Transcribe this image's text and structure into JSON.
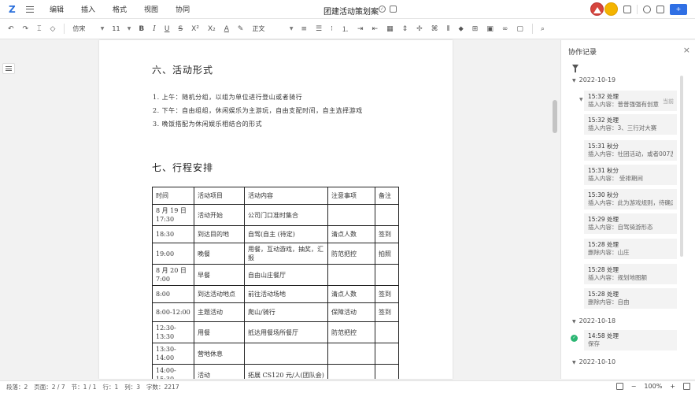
{
  "menubar": {
    "logo": "Z",
    "items": [
      "编辑",
      "插入",
      "格式",
      "视图",
      "协同"
    ],
    "doc_title": "团建活动策划案",
    "share_label": "+"
  },
  "toolbar": {
    "font_family": "仿宋",
    "font_size": "11",
    "bold": "B",
    "italic": "I",
    "underline": "U",
    "strike": "S",
    "superscript": "X²",
    "subscript": "X₂",
    "font_color": "A",
    "style": "正文"
  },
  "document": {
    "section6_title": "六、活动形式",
    "section6_items": [
      "1.  上午：随机分组，以组为单位进行登山或者骑行",
      "2.  下午：自由组组，休闲娱乐为主游玩，自由支配时间，自主选择游戏",
      "3.  晚饭搭配为休闲娱乐相结合的形式"
    ],
    "section7_title": "七、行程安排",
    "table": {
      "headers": [
        "时间",
        "活动项目",
        "活动内容",
        "注意事项",
        "备注"
      ],
      "rows": [
        [
          "8 月 19 日 17:30",
          "活动开始",
          "公司门口准时集合",
          "",
          ""
        ],
        [
          "18:30",
          "到达目的地",
          "自驾(自主 (待定)",
          "清点人数",
          "签到"
        ],
        [
          "19:00",
          "晚餐",
          "用餐，互动游戏，抽奖，汇报",
          "防范把控",
          "拍照"
        ],
        [
          "8 月 20 日 7:00",
          "早餐",
          "自由山庄餐厅",
          "",
          ""
        ],
        [
          "8:00",
          "到达活动地点",
          "前往活动场地",
          "清点人数",
          "签到"
        ],
        [
          "8:00-12:00",
          "主题活动",
          "爬山/骑行",
          "保障活动",
          "签到"
        ],
        [
          "12:30-13:30",
          "用餐",
          "抵达用餐场所餐厅",
          "防范把控",
          ""
        ],
        [
          "13:30-14:00",
          "营地休息",
          "",
          "",
          ""
        ],
        [
          "14:00-15:30",
          "活动",
          "拓展 CS120 元/人(团队会)",
          "",
          ""
        ]
      ]
    }
  },
  "panel": {
    "title": "协作记录",
    "close": "×",
    "groups": [
      {
        "date": "2022-10-19",
        "entries": [
          {
            "who": "15:32 处理",
            "what": "插入内容：普普强强有创意",
            "current": "当前"
          },
          {
            "who": "15:32 处理",
            "what": "插入内容：3、三行对大赛"
          },
          {
            "who": "15:31 秋分",
            "what": "插入内容：社团活动，或者007游戏"
          },
          {
            "who": "15:31 秋分",
            "what": "插入内容：  受排期间"
          },
          {
            "who": "15:30 秋分",
            "what": "插入内容：此为游戏规则，待确定"
          },
          {
            "who": "15:29 处理",
            "what": "插入内容：自驾骑游形态"
          },
          {
            "who": "15:28 处理",
            "what": "删除内容：山庄"
          },
          {
            "who": "15:28 处理",
            "what": "插入内容：规划地图额"
          },
          {
            "who": "15:28 处理",
            "what": "删除内容：自由"
          }
        ]
      },
      {
        "date": "2022-10-18",
        "entries": [
          {
            "who": "14:58 处理",
            "what": "保存"
          }
        ]
      },
      {
        "date": "2022-10-10",
        "entries": []
      }
    ]
  },
  "statusbar": {
    "items": [
      "段落：2",
      "页面：2 / 7",
      "节：1 / 1",
      "行：1",
      "列：3",
      "字数：2217"
    ],
    "zoom": "100%"
  },
  "colors": {
    "accent": "#2f6fe4",
    "avatar_red": "#d6453c",
    "avatar_yellow": "#f4b400",
    "saved_green": "#2bb673"
  }
}
